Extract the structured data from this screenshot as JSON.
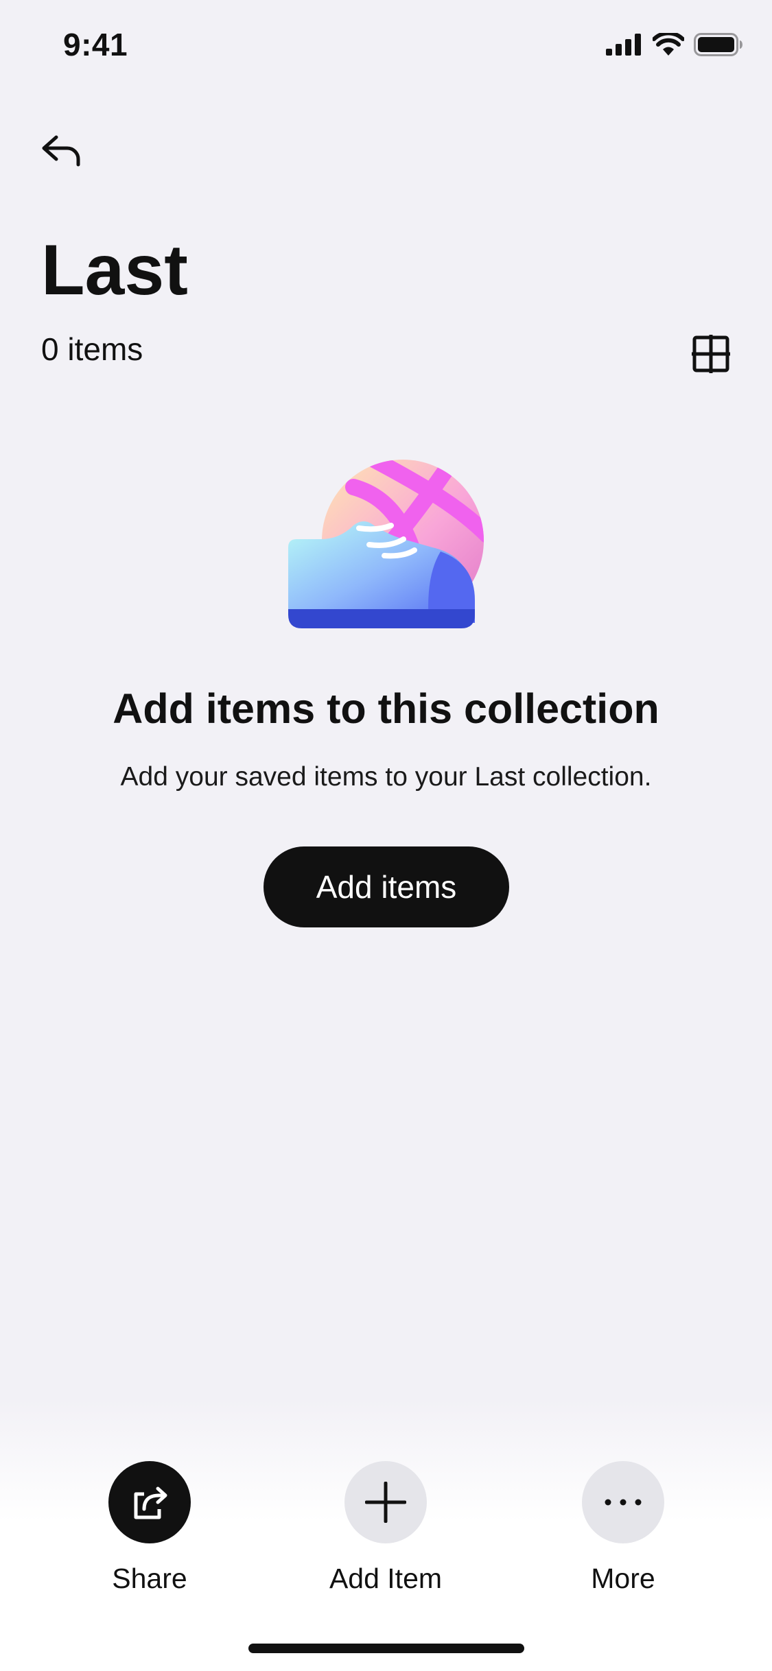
{
  "status_bar": {
    "time": "9:41"
  },
  "header": {
    "title": "Last",
    "item_count": "0 items"
  },
  "empty_state": {
    "title": "Add items to this collection",
    "description": "Add your saved items to your Last collection.",
    "button_label": "Add items"
  },
  "actions": {
    "share": {
      "label": "Share",
      "icon": "share-icon"
    },
    "add_item": {
      "label": "Add Item",
      "icon": "plus-icon"
    },
    "more": {
      "label": "More",
      "icon": "ellipsis-icon"
    }
  },
  "colors": {
    "background": "#f2f1f6",
    "primary": "#111111",
    "light_button": "#e5e5ea",
    "ball_pink": "#f062ee",
    "shoe_blue": "#4e63f0"
  }
}
